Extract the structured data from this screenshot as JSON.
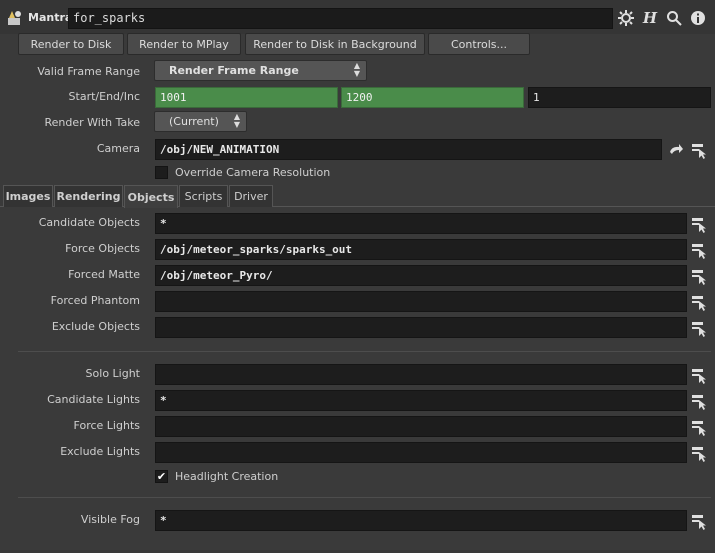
{
  "header": {
    "node_type": "Mantra",
    "node_name": "for_sparks",
    "help_icon_text": "H"
  },
  "buttons": {
    "render_to_disk": "Render to Disk",
    "render_to_mplay": "Render to MPlay",
    "render_bg": "Render to Disk in Background",
    "controls": "Controls..."
  },
  "params": {
    "valid_frame_range": {
      "label": "Valid Frame Range",
      "value": "Render Frame Range"
    },
    "start_end_inc": {
      "label": "Start/End/Inc",
      "start": "1001",
      "end": "1200",
      "inc": "1"
    },
    "render_with_take": {
      "label": "Render With Take",
      "value": "(Current)"
    },
    "camera": {
      "label": "Camera",
      "value": "/obj/NEW_ANIMATION"
    },
    "override_cam_res": {
      "label": "Override Camera Resolution",
      "checked": false
    }
  },
  "tabs": [
    "Images",
    "Rendering",
    "Objects",
    "Scripts",
    "Driver"
  ],
  "objects": {
    "candidate_objects": {
      "label": "Candidate Objects",
      "value": "*"
    },
    "force_objects": {
      "label": "Force Objects",
      "value": "/obj/meteor_sparks/sparks_out"
    },
    "forced_matte": {
      "label": "Forced Matte",
      "value": "/obj/meteor_Pyro/"
    },
    "forced_phantom": {
      "label": "Forced Phantom",
      "value": ""
    },
    "exclude_objects": {
      "label": "Exclude Objects",
      "value": ""
    },
    "solo_light": {
      "label": "Solo Light",
      "value": ""
    },
    "candidate_lights": {
      "label": "Candidate Lights",
      "value": "*"
    },
    "force_lights": {
      "label": "Force Lights",
      "value": ""
    },
    "exclude_lights": {
      "label": "Exclude Lights",
      "value": ""
    },
    "headlight_creation": {
      "label": "Headlight Creation",
      "checked": true
    },
    "visible_fog": {
      "label": "Visible Fog",
      "value": "*"
    }
  },
  "colors": {
    "accent_green": "#4a8c4a",
    "background": "#3a3a3a",
    "field": "#1d1d1d"
  }
}
